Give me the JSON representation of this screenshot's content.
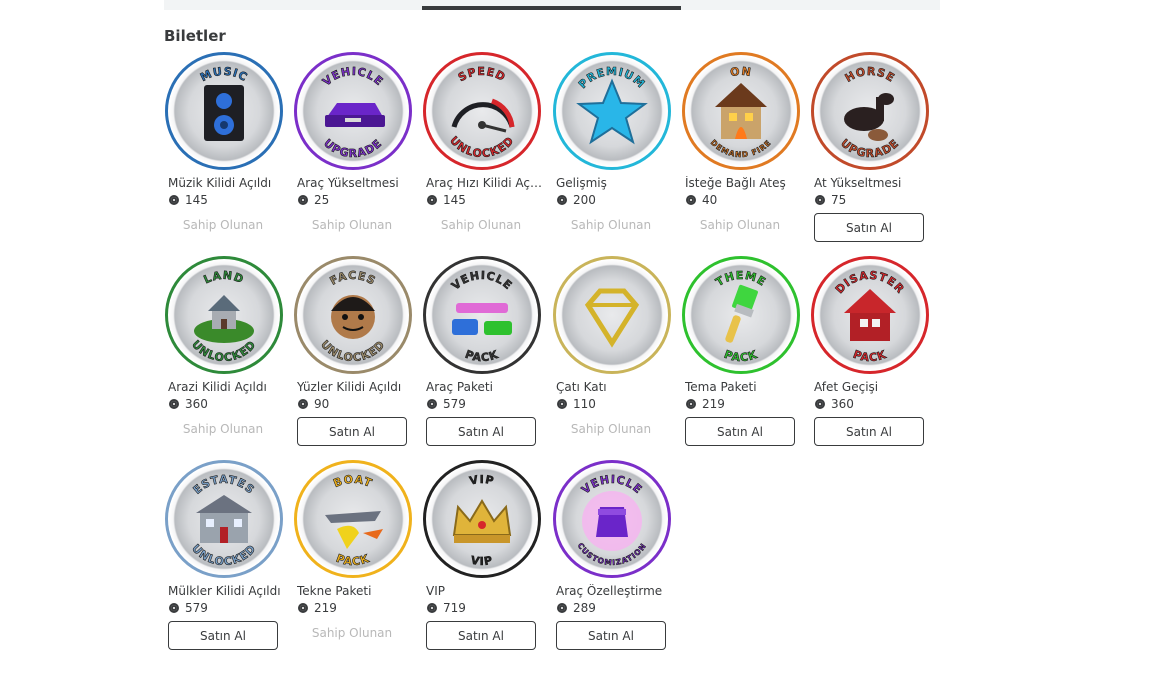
{
  "section_title": "Biletler",
  "owned_label": "Sahip Olunan",
  "buy_label": "Satın Al",
  "passes": [
    {
      "name": "Müzik Kilidi Açıldı",
      "price": "145",
      "status": "owned",
      "badge_top": "MUSIC",
      "badge_bottom": "",
      "ring": "#2a6fb5",
      "icon": "speaker-icon"
    },
    {
      "name": "Araç Yükseltmesi",
      "price": "25",
      "status": "owned",
      "badge_top": "VEHICLE",
      "badge_bottom": "UPGRADE",
      "ring": "#7b2fc9",
      "icon": "purple-car-icon"
    },
    {
      "name": "Araç Hızı Kilidi Açıldı",
      "price": "145",
      "status": "owned",
      "badge_top": "SPEED",
      "badge_bottom": "UNLOCKED",
      "ring": "#d6262b",
      "icon": "speedometer-icon"
    },
    {
      "name": "Gelişmiş",
      "price": "200",
      "status": "owned",
      "badge_top": "PREMIUM",
      "badge_bottom": "",
      "ring": "#23b7d9",
      "icon": "star-icon"
    },
    {
      "name": "İsteğe Bağlı Ateş",
      "price": "40",
      "status": "owned",
      "badge_top": "ON",
      "badge_bottom": "DEMAND FIRE",
      "ring": "#e07a22",
      "icon": "burning-house-icon"
    },
    {
      "name": "At Yükseltmesi",
      "price": "75",
      "status": "buy",
      "badge_top": "HORSE",
      "badge_bottom": "UPGRADE",
      "ring": "#c14a2a",
      "icon": "horse-icon"
    },
    {
      "name": "Arazi Kilidi Açıldı",
      "price": "360",
      "status": "owned",
      "badge_top": "LAND",
      "badge_bottom": "UNLOCKED",
      "ring": "#2e8a3a",
      "icon": "island-house-icon"
    },
    {
      "name": "Yüzler Kilidi Açıldı",
      "price": "90",
      "status": "buy",
      "badge_top": "FACES",
      "badge_bottom": "UNLOCKED",
      "ring": "#9a8a6a",
      "icon": "face-icon"
    },
    {
      "name": "Araç Paketi",
      "price": "579",
      "status": "buy",
      "badge_top": "VEHICLE",
      "badge_bottom": "PACK",
      "ring": "#333333",
      "icon": "cars-icon"
    },
    {
      "name": "Çatı Katı",
      "price": "110",
      "status": "owned",
      "badge_top": "",
      "badge_bottom": "",
      "ring": "#c9b45a",
      "icon": "diamond-icon"
    },
    {
      "name": "Tema Paketi",
      "price": "219",
      "status": "buy",
      "badge_top": "THEME",
      "badge_bottom": "PACK",
      "ring": "#2ec12e",
      "icon": "paintbrush-icon"
    },
    {
      "name": "Afet Geçişi",
      "price": "360",
      "status": "buy",
      "badge_top": "DISASTER",
      "badge_bottom": "PACK",
      "ring": "#d6262b",
      "icon": "broken-house-icon"
    },
    {
      "name": "Mülkler Kilidi Açıldı",
      "price": "579",
      "status": "buy",
      "badge_top": "ESTATES",
      "badge_bottom": "UNLOCKED",
      "ring": "#7aa0c8",
      "icon": "mansion-icon"
    },
    {
      "name": "Tekne Paketi",
      "price": "219",
      "status": "owned",
      "badge_top": "BOAT",
      "badge_bottom": "PACK",
      "ring": "#f0b21c",
      "icon": "boat-icon"
    },
    {
      "name": "VIP",
      "price": "719",
      "status": "buy",
      "badge_top": "VIP",
      "badge_bottom": "VIP",
      "ring": "#222222",
      "icon": "crown-icon"
    },
    {
      "name": "Araç Özelleştirme",
      "price": "289",
      "status": "buy",
      "badge_top": "VEHICLE",
      "badge_bottom": "CUSTOMIZATION",
      "ring": "#7b2fc9",
      "icon": "purple-car-glow-icon"
    }
  ]
}
